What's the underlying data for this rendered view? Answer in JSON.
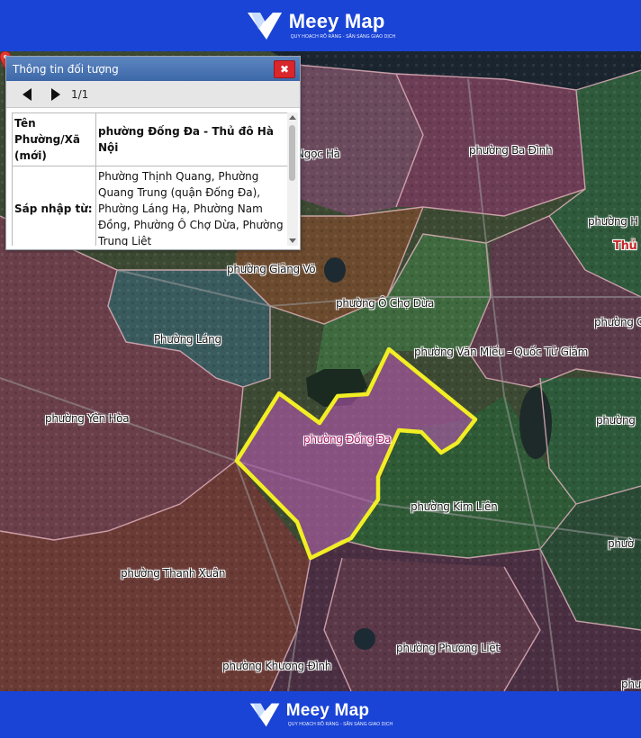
{
  "brand": {
    "name": "Meey Map",
    "tagline": "QUY HOẠCH RÕ RÀNG - SẴN SÀNG GIAO DỊCH"
  },
  "colors": {
    "brand_bar": "#1a44d6",
    "highlight_outline": "#f2ee24",
    "highlight_fill": "#c45ac0",
    "popup_header": "#4a75b4",
    "close_button": "#d9262b",
    "pin": "#e53935"
  },
  "popup": {
    "title": "Thông tin đối tượng",
    "close_icon": "close-icon",
    "counter": "1/1",
    "rows": [
      {
        "key": "Tên Phường/Xã (mới)",
        "value": "phường Đống Đa - Thủ đô Hà Nội"
      },
      {
        "key": "Sáp nhập từ:",
        "value": "Phường Thịnh Quang, Phường Quang Trung (quận Đống Đa), Phường Láng Hạ, Phường Nam Đồng, Phường Ô Chợ Dừa, Phường Trung Liệt"
      }
    ]
  },
  "map": {
    "labels": {
      "ngoc_ha": "phường Ngọc Hà",
      "ba_dinh": "phường Ba Đình",
      "hoan_kiem": "phường H",
      "thu_do": "Thủ",
      "giang_vo": "phường Giảng Võ",
      "o_cho_dua": "phường Ô Chợ Dừa",
      "lang": "Phường Láng",
      "van_mieu": "phường Văn Miếu - Quốc Tử Giám",
      "cua_nam": "phường C",
      "yen_hoa": "phường Yên Hòa",
      "dong_da": "phường Đống Đa",
      "hai_ba_trung": "phường",
      "kim_lien": "phường Kim Liên",
      "bach_mai": "phườ",
      "thanh_xuan": "phường Thanh Xuân",
      "phuong_liet": "phường Phương Liệt",
      "khuong_dinh": "phường Khương Đình",
      "tuong_mai": "phư"
    }
  }
}
